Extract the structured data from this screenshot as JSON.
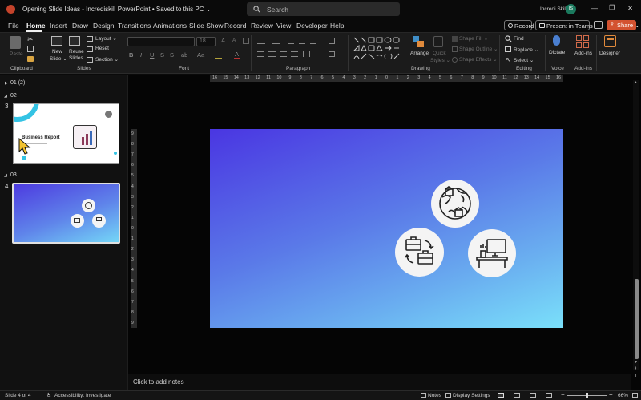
{
  "titlebar": {
    "doc_title": "Opening Slide Ideas - Incrediskill PowerPoint • Saved to this PC ⌄",
    "search_placeholder": "Search",
    "user_name": "Incredi Skill",
    "avatar_initials": "IS",
    "minimize": "—",
    "maximize": "❐",
    "close": "✕"
  },
  "menu": {
    "items": [
      "File",
      "Home",
      "Insert",
      "Draw",
      "Design",
      "Transitions",
      "Animations",
      "Slide Show",
      "Record",
      "Review",
      "View",
      "Developer",
      "Help"
    ],
    "record_button": "Record",
    "present_button": "Present in Teams",
    "share_button": "Share ⌄"
  },
  "ribbon": {
    "clipboard": {
      "paste": "Paste",
      "group": "Clipboard"
    },
    "slides": {
      "new_slide": "New",
      "new_slide2": "Slide ⌄",
      "reuse": "Reuse",
      "reuse2": "Slides",
      "layout": "Layout ⌄",
      "reset": "Reset",
      "section": "Section ⌄",
      "group": "Slides"
    },
    "font": {
      "font_size": "18",
      "grow": "A",
      "shrink": "A",
      "bold": "B",
      "italic": "I",
      "underline": "U",
      "strike": "S",
      "spacing": "ab",
      "case": "Aa",
      "color": "A",
      "group": "Font"
    },
    "paragraph": {
      "group": "Paragraph"
    },
    "drawing": {
      "arrange": "Arrange",
      "quick_styles": "Quick",
      "quick_styles2": "Styles ⌄",
      "shape_fill": "Shape Fill ⌄",
      "shape_outline": "Shape Outline ⌄",
      "shape_effects": "Shape Effects ⌄",
      "group": "Drawing"
    },
    "editing": {
      "find": "Find",
      "replace": "Replace ⌄",
      "select": "Select ⌄",
      "group": "Editing"
    },
    "voice": {
      "dictate": "Dictate",
      "group": "Voice"
    },
    "addins": {
      "addins": "Add-ins",
      "group": "Add-ins"
    },
    "designer": {
      "designer": "Designer"
    }
  },
  "slides_panel": {
    "sections": [
      {
        "label": "01 (2)"
      },
      {
        "label": "02"
      },
      {
        "label": "03"
      }
    ],
    "slide3": {
      "number": "3",
      "title": "Business Report"
    },
    "slide4": {
      "number": "4"
    }
  },
  "ruler": {
    "h_labels": [
      "16",
      "15",
      "14",
      "13",
      "12",
      "11",
      "10",
      "9",
      "8",
      "7",
      "6",
      "5",
      "4",
      "3",
      "2",
      "1",
      "0",
      "1",
      "2",
      "3",
      "4",
      "5",
      "6",
      "7",
      "8",
      "9",
      "10",
      "11",
      "12",
      "13",
      "14",
      "15",
      "16"
    ],
    "v_labels": [
      "9",
      "8",
      "7",
      "6",
      "5",
      "4",
      "3",
      "2",
      "1",
      "0",
      "1",
      "2",
      "3",
      "4",
      "5",
      "6",
      "7",
      "8",
      "9"
    ]
  },
  "notes": {
    "placeholder": "Click to add notes"
  },
  "status": {
    "slide_info": "Slide 4 of 4",
    "accessibility": "Accessibility: Investigate",
    "notes": "Notes",
    "display_settings": "Display Settings",
    "zoom": "66%",
    "minus": "−",
    "plus": "+"
  }
}
